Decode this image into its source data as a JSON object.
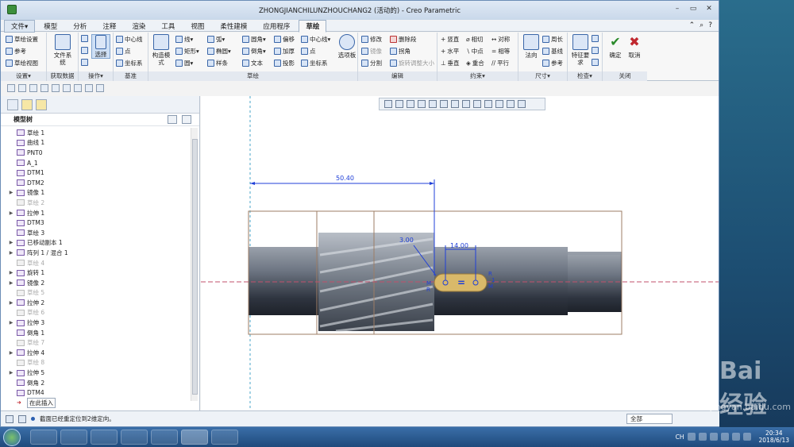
{
  "window": {
    "title": "ZHONGJIANCHILUNZHOUCHANG2 (活动的) - Creo Parametric"
  },
  "menu": {
    "tabs": [
      "文件▾",
      "模型",
      "分析",
      "注释",
      "渲染",
      "工具",
      "视图",
      "柔性建模",
      "应用程序",
      "草绘"
    ],
    "active_tab": "草绘"
  },
  "ribbon": {
    "settings": {
      "items": [
        "草绘设置",
        "参考",
        "草绘视图"
      ],
      "label": "设置▾"
    },
    "getdata": {
      "btn": "文件系统",
      "label": "获取数据"
    },
    "ops": {
      "btn": "选择",
      "label": "操作▾"
    },
    "datum": {
      "items": [
        "中心线",
        "点",
        "坐标系"
      ],
      "label": "基准"
    },
    "sketch": {
      "construct": "构造模式",
      "col1": [
        "线▾",
        "矩形▾",
        "圆▾"
      ],
      "col2": [
        "弧▾",
        "椭圆▾",
        "样条"
      ],
      "col3": [
        "圆角▾",
        "倒角▾",
        "文本"
      ],
      "col4": [
        "偏移",
        "加厚",
        "投影"
      ],
      "col5": [
        "中心线▾",
        "点",
        "坐标系"
      ],
      "palette": "选项板",
      "label": "草绘"
    },
    "edit": {
      "items": [
        "修改",
        "删除段",
        "镜像",
        "拐角",
        "分割",
        "旋转调整大小"
      ],
      "label": "编辑"
    },
    "constraint": {
      "items": [
        "竖直",
        "相切",
        "对称",
        "水平",
        "中点",
        "相等",
        "垂直",
        "重合",
        "平行"
      ],
      "label": "约束▾"
    },
    "dimension": {
      "btn": "法向",
      "items": [
        "周长",
        "基线",
        "参考"
      ],
      "label": "尺寸▾"
    },
    "inspect": {
      "btn": "特征要求",
      "label": "检查▾"
    },
    "close": {
      "ok": "确定",
      "cancel": "取消",
      "label": "关闭"
    }
  },
  "tree": {
    "header": "模型树",
    "rows": [
      {
        "label": "草绘 1",
        "dim": false,
        "exp": ""
      },
      {
        "label": "曲线 1",
        "dim": false,
        "exp": ""
      },
      {
        "label": "PNT0",
        "dim": false,
        "exp": ""
      },
      {
        "label": "A_1",
        "dim": false,
        "exp": ""
      },
      {
        "label": "DTM1",
        "dim": false,
        "exp": ""
      },
      {
        "label": "DTM2",
        "dim": false,
        "exp": ""
      },
      {
        "label": "镜像 1",
        "dim": false,
        "exp": "▶"
      },
      {
        "label": "草绘 2",
        "dim": true,
        "exp": ""
      },
      {
        "label": "拉伸 1",
        "dim": false,
        "exp": "▶"
      },
      {
        "label": "DTM3",
        "dim": false,
        "exp": ""
      },
      {
        "label": "草绘 3",
        "dim": false,
        "exp": ""
      },
      {
        "label": "已移动副本 1",
        "dim": false,
        "exp": "▶"
      },
      {
        "label": "阵列 1 / 混合 1",
        "dim": false,
        "exp": "▶"
      },
      {
        "label": "草绘 4",
        "dim": true,
        "exp": ""
      },
      {
        "label": "旋转 1",
        "dim": false,
        "exp": "▶"
      },
      {
        "label": "镜像 2",
        "dim": false,
        "exp": "▶"
      },
      {
        "label": "草绘 5",
        "dim": true,
        "exp": ""
      },
      {
        "label": "拉伸 2",
        "dim": false,
        "exp": "▶"
      },
      {
        "label": "草绘 6",
        "dim": true,
        "exp": ""
      },
      {
        "label": "拉伸 3",
        "dim": false,
        "exp": "▶"
      },
      {
        "label": "倒角 1",
        "dim": false,
        "exp": ""
      },
      {
        "label": "草绘 7",
        "dim": true,
        "exp": ""
      },
      {
        "label": "拉伸 4",
        "dim": false,
        "exp": "▶"
      },
      {
        "label": "草绘 8",
        "dim": true,
        "exp": ""
      },
      {
        "label": "拉伸 5",
        "dim": false,
        "exp": "▶"
      },
      {
        "label": "倒角 2",
        "dim": false,
        "exp": ""
      },
      {
        "label": "DTM4",
        "dim": false,
        "exp": ""
      },
      {
        "label": "在此插入",
        "dim": false,
        "exp": "",
        "insert": true
      }
    ]
  },
  "graphics": {
    "dim_length": "50.40",
    "dim_slot": "14.00",
    "dim_radius": "3.00",
    "constraint_r": "R",
    "constraint_1": "1",
    "constraint_m": "M"
  },
  "status": {
    "message": "截面已经重定位到2维定向。",
    "filter": "全部"
  },
  "taskbar": {
    "lang": "CH",
    "time": "20:34",
    "date": "2018/6/13"
  },
  "watermark": {
    "main": "Bai 经验",
    "sub": "jingyan.baidu.com"
  },
  "colors": {
    "accent": "#2b5fb0",
    "sketch_blue": "#1f3fd8",
    "slot_fill": "#d9b96a",
    "axis_red": "#c0506b"
  }
}
